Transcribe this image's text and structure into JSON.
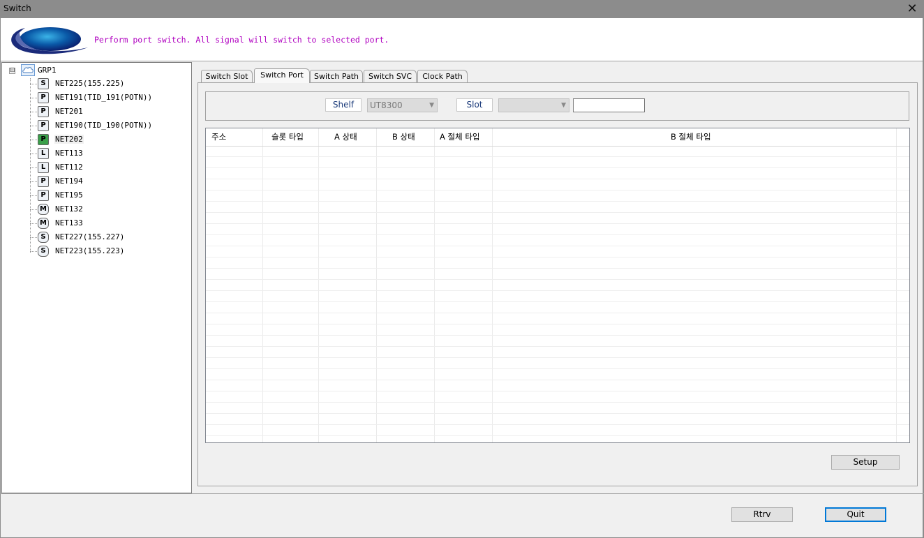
{
  "window": {
    "title": "Switch",
    "close_glyph": "✕"
  },
  "banner": {
    "message": "Perform port switch. All signal will switch to selected port.",
    "logo_icon": "company-logo-icon"
  },
  "tree": {
    "root": {
      "label": "GRP1",
      "icon": "cloud-group-icon",
      "expander": "⊟"
    },
    "nodes": [
      {
        "icon_text": "S",
        "label": "NET225(155.225)"
      },
      {
        "icon_text": "P",
        "label": "NET191(TID_191(POTN))"
      },
      {
        "icon_text": "P",
        "label": "NET201"
      },
      {
        "icon_text": "P",
        "label": "NET190(TID_190(POTN))"
      },
      {
        "icon_text": "P",
        "label": "NET202"
      },
      {
        "icon_text": "L",
        "label": "NET113"
      },
      {
        "icon_text": "L",
        "label": "NET112"
      },
      {
        "icon_text": "P",
        "label": "NET194"
      },
      {
        "icon_text": "P",
        "label": "NET195"
      },
      {
        "icon_text": "M",
        "label": "NET132"
      },
      {
        "icon_text": "M",
        "label": "NET133"
      },
      {
        "icon_text": "S",
        "label": "NET227(155.227)"
      },
      {
        "icon_text": "S",
        "label": "NET223(155.223)"
      }
    ]
  },
  "tabs": [
    {
      "label": "Switch Slot"
    },
    {
      "label": "Switch Port"
    },
    {
      "label": "Switch Path"
    },
    {
      "label": "Switch SVC"
    },
    {
      "label": "Clock Path"
    }
  ],
  "filter": {
    "shelf_label": "Shelf",
    "shelf_value": "UT8300",
    "slot_label": "Slot",
    "slot_value": "",
    "text_value": ""
  },
  "grid": {
    "columns": [
      "주소",
      "슬롯 타입",
      "A 상태",
      "B 상태",
      "A 절체 타입",
      "B 절체 타입"
    ],
    "rows": []
  },
  "buttons": {
    "setup": "Setup",
    "rtrv": "Rtrv",
    "quit": "Quit"
  },
  "colors": {
    "message": "#b000c0",
    "selected_node_icon": "#3aa04a",
    "default_button_border": "#0078d7"
  }
}
